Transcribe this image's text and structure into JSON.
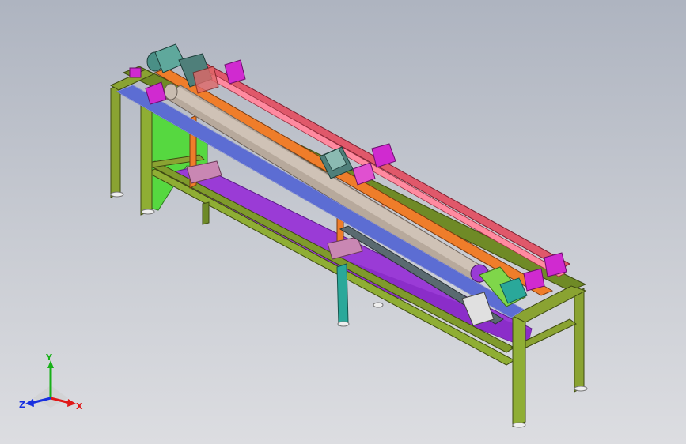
{
  "triad": {
    "x_label": "X",
    "y_label": "Y",
    "z_label": "Z"
  },
  "colors": {
    "background_top": "#aeb4c0",
    "background_bottom": "#dcdde1",
    "frame": "#7f9a2c",
    "panel_green": "#56d840",
    "panel_purple": "#9a3bd6",
    "rail_blue": "#5c6dd3",
    "rail_orange": "#ef7d2a",
    "rail_red": "#e0586a",
    "tube": "#b7a99c",
    "carriage": "#4f7f7a",
    "bracket_magenta": "#d02ad0",
    "leg_teal": "#2aa89a",
    "axis_x": "#e01818",
    "axis_y": "#18b018",
    "axis_z": "#1830e0"
  }
}
